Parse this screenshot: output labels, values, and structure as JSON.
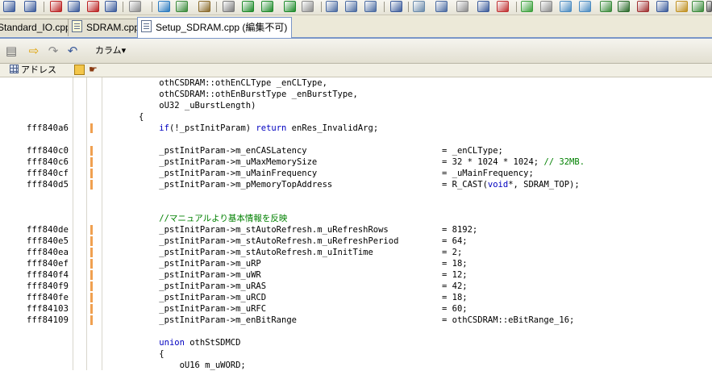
{
  "tabs": [
    {
      "label": "Standard_IO.cpp",
      "active": false
    },
    {
      "label": "SDRAM.cpp",
      "active": false
    },
    {
      "label": "Setup_SDRAM.cpp (編集不可)",
      "active": true
    }
  ],
  "toolbar2": {
    "column_label": "カラム▾"
  },
  "column_header": {
    "address_label": "アドレス"
  },
  "code_rows": [
    {
      "addr": "",
      "bar": false,
      "src": "    othCSDRAM::othEnCLType _enCLType,",
      "rhs": ""
    },
    {
      "addr": "",
      "bar": false,
      "src": "    othCSDRAM::othEnBurstType _enBurstType,",
      "rhs": ""
    },
    {
      "addr": "",
      "bar": false,
      "src": "    oU32 _uBurstLength)",
      "rhs": ""
    },
    {
      "addr": "",
      "bar": false,
      "src": "{",
      "rhs": ""
    },
    {
      "addr": "fff840a6",
      "bar": true,
      "src": "    if(!_pstInitParam) return enRes_InvalidArg;",
      "rhs": ""
    },
    {
      "addr": "",
      "bar": false,
      "src": "",
      "rhs": ""
    },
    {
      "addr": "fff840c0",
      "bar": true,
      "src": "    _pstInitParam->m_enCASLatency",
      "rhs": "= _enCLType;"
    },
    {
      "addr": "fff840c6",
      "bar": true,
      "src": "    _pstInitParam->m_uMaxMemorySize",
      "rhs": "= 32 * 1024 * 1024; // 32MB."
    },
    {
      "addr": "fff840cf",
      "bar": true,
      "src": "    _pstInitParam->m_uMainFrequency",
      "rhs": "= _uMainFrequency;"
    },
    {
      "addr": "fff840d5",
      "bar": true,
      "src": "    _pstInitParam->m_pMemoryTopAddress",
      "rhs": "= R_CAST(void*, SDRAM_TOP);"
    },
    {
      "addr": "",
      "bar": false,
      "src": "",
      "rhs": ""
    },
    {
      "addr": "",
      "bar": false,
      "src": "",
      "rhs": ""
    },
    {
      "addr": "",
      "bar": false,
      "src": "    //マニュアルより基本情報を反映",
      "rhs": "",
      "comment": true
    },
    {
      "addr": "fff840de",
      "bar": true,
      "src": "    _pstInitParam->m_stAutoRefresh.m_uRefreshRows",
      "rhs": "= 8192;"
    },
    {
      "addr": "fff840e5",
      "bar": true,
      "src": "    _pstInitParam->m_stAutoRefresh.m_uRefreshPeriod",
      "rhs": "= 64;"
    },
    {
      "addr": "fff840ea",
      "bar": true,
      "src": "    _pstInitParam->m_stAutoRefresh.m_uInitTime",
      "rhs": "= 2;"
    },
    {
      "addr": "fff840ef",
      "bar": true,
      "src": "    _pstInitParam->m_uRP",
      "rhs": "= 18;"
    },
    {
      "addr": "fff840f4",
      "bar": true,
      "src": "    _pstInitParam->m_uWR",
      "rhs": "= 12;"
    },
    {
      "addr": "fff840f9",
      "bar": true,
      "src": "    _pstInitParam->m_uRAS",
      "rhs": "= 42;"
    },
    {
      "addr": "fff840fe",
      "bar": true,
      "src": "    _pstInitParam->m_uRCD",
      "rhs": "= 18;"
    },
    {
      "addr": "fff84103",
      "bar": true,
      "src": "    _pstInitParam->m_uRFC",
      "rhs": "= 60;"
    },
    {
      "addr": "fff84109",
      "bar": true,
      "src": "    _pstInitParam->m_enBitRange",
      "rhs": "= othCSDRAM::eBitRange_16;"
    },
    {
      "addr": "",
      "bar": false,
      "src": "",
      "rhs": ""
    },
    {
      "addr": "",
      "bar": false,
      "src": "    union othStSDMCD",
      "rhs": "",
      "union": true
    },
    {
      "addr": "",
      "bar": false,
      "src": "    {",
      "rhs": ""
    },
    {
      "addr": "",
      "bar": false,
      "src": "        oU16 m_uWORD;",
      "rhs": ""
    }
  ],
  "colors": {
    "bar": "#f0a050",
    "comment": "#008000",
    "keyword": "#0000c0",
    "tab_border": "#7a96c8"
  }
}
